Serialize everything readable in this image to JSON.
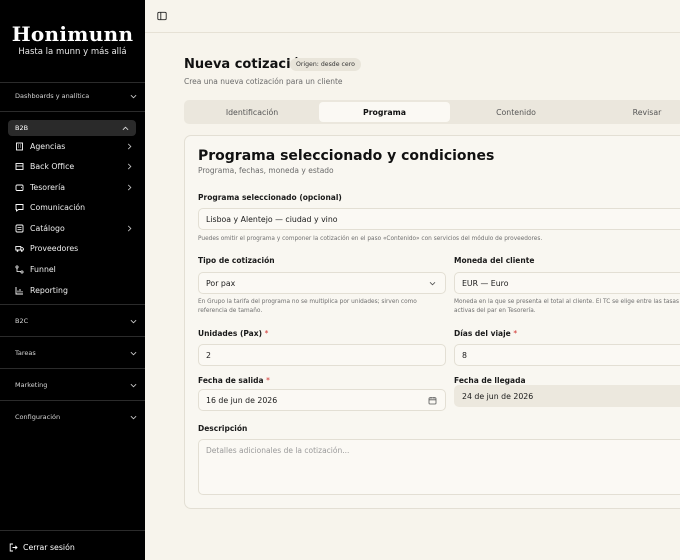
{
  "sidebar": {
    "brand": "Honimunn",
    "tagline": "Hasta la munn y más allá",
    "sections": {
      "dashboards": "Dashboards y analítica",
      "b2b": "B2B",
      "b2c": "B2C",
      "tareas": "Tareas",
      "marketing": "Marketing",
      "configuracion": "Configuración"
    },
    "items": [
      {
        "label": "Agencias",
        "icon": "building-icon",
        "has_chevron": true
      },
      {
        "label": "Back Office",
        "icon": "office-icon",
        "has_chevron": true
      },
      {
        "label": "Tesorería",
        "icon": "wallet-icon",
        "has_chevron": true
      },
      {
        "label": "Comunicación",
        "icon": "chat-icon",
        "has_chevron": false
      },
      {
        "label": "Catálogo",
        "icon": "catalog-icon",
        "has_chevron": true
      },
      {
        "label": "Proveedores",
        "icon": "truck-icon",
        "has_chevron": false
      },
      {
        "label": "Funnel",
        "icon": "funnel-icon",
        "has_chevron": false
      },
      {
        "label": "Reporting",
        "icon": "chart-icon",
        "has_chevron": false
      }
    ],
    "logout": "Cerrar sesión"
  },
  "header": {
    "title": "Nueva cotización",
    "origin_badge": "Origen: desde cero",
    "subtitle": "Crea una nueva cotización para un cliente"
  },
  "tabs": [
    {
      "label": "Identificación",
      "active": false
    },
    {
      "label": "Programa",
      "active": true
    },
    {
      "label": "Contenido",
      "active": false
    },
    {
      "label": "Revisar",
      "active": false
    }
  ],
  "card": {
    "title": "Programa seleccionado y condiciones",
    "subtitle": "Programa, fechas, moneda y estado",
    "programa": {
      "label": "Programa seleccionado (opcional)",
      "value": "Lisboa y Alentejo — ciudad y vino",
      "help": "Puedes omitir el programa y componer la cotización en el paso «Contenido» con servicios del módulo de proveedores."
    },
    "tipo": {
      "label": "Tipo de cotización",
      "value": "Por pax",
      "help": "En Grupo la tarifa del programa no se multiplica por unidades; sirven como referencia de tamaño."
    },
    "moneda": {
      "label": "Moneda del cliente",
      "value": "EUR — Euro",
      "help": "Moneda en la que se presenta el total al cliente. El TC se elige entre las tasas activas del par en Tesorería."
    },
    "unidades": {
      "label": "Unidades (Pax)",
      "required": "*",
      "value": "2"
    },
    "dias": {
      "label": "Días del viaje",
      "required": "*",
      "value": "8"
    },
    "salida": {
      "label": "Fecha de salida",
      "required": "*",
      "value": "16 de jun de 2026"
    },
    "llegada": {
      "label": "Fecha de llegada",
      "value": "24 de jun de 2026"
    },
    "descripcion": {
      "label": "Descripción",
      "placeholder": "Detalles adicionales de la cotización..."
    }
  }
}
